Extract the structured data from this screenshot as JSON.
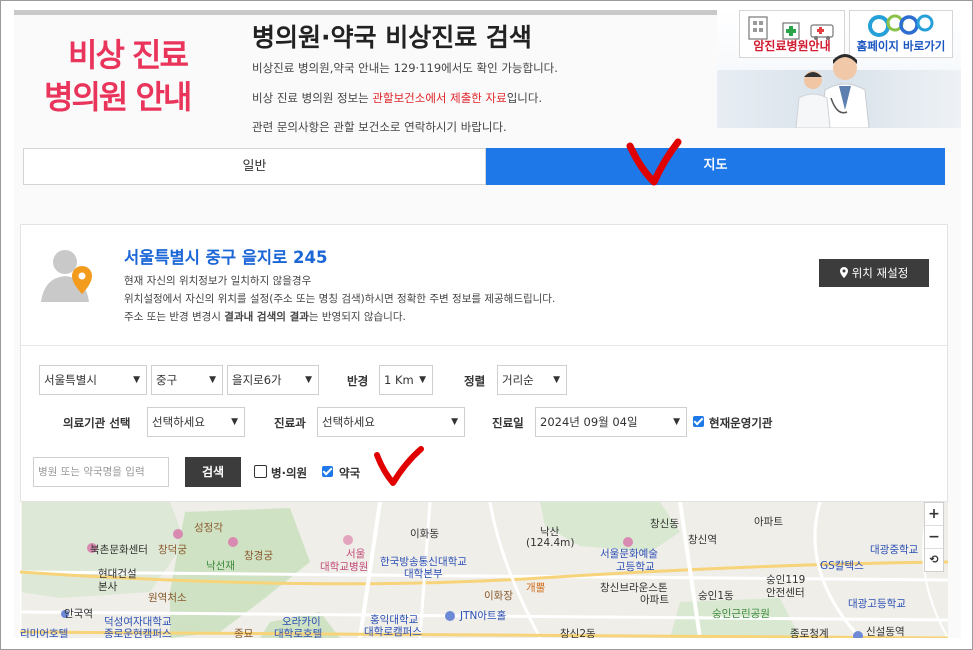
{
  "header": {
    "promo_line1": "비상 진료",
    "promo_line2": "병의원 안내",
    "title": "병의원·약국 비상진료 검색",
    "desc1": "비상진료 병의원,약국 안내는 129·119에서도 확인 가능합니다.",
    "desc2_pre": "비상 진료 병의원 정보는 ",
    "desc2_red": "관할보건소에서 제출한 자료",
    "desc2_post": "입니다.",
    "desc3": "관련 문의사항은 관할 보건소로 연락하시기 바랍니다.",
    "banner_btn1": "암진료병원안내",
    "banner_btn2": "홈페이지 바로가기",
    "banner_logo_text": "C C C"
  },
  "tabs": [
    {
      "label": "일반",
      "active": false
    },
    {
      "label": "지도",
      "active": true
    }
  ],
  "location": {
    "address": "서울특별시 중구 을지로 245",
    "info1": "현재 자신의 위치정보가 일치하지 않을경우",
    "info2": "위치설정에서 자신의 위치를 설정(주소 또는 명칭 검색)하시면 정확한 주변 정보를 제공해드립니다.",
    "info3_pre": "주소 또는 반경 변경시 ",
    "info3_bold": "결과내 검색의 결과",
    "info3_post": "는 반영되지 않습니다.",
    "reset_button": "위치 재설정"
  },
  "filters": {
    "city": "서울특별시",
    "district": "중구",
    "dong": "을지로6가",
    "radius_label": "반경",
    "radius": "1 Km",
    "sort_label": "정렬",
    "sort": "거리순",
    "facility_label": "의료기관 선택",
    "facility": "선택하세요",
    "dept_label": "진료과",
    "dept": "선택하세요",
    "date_label": "진료일",
    "date": "2024년 09월 04일",
    "open_now_label": "현재운영기관",
    "open_now": true,
    "search_placeholder": "병원 또는 약국명을 입력",
    "search_button": "검색",
    "clinic_label": "병·의원",
    "clinic_checked": false,
    "pharmacy_label": "약국",
    "pharmacy_checked": true
  },
  "map": {
    "labels": [
      "성정각",
      "창덕궁",
      "북촌문화센터",
      "현대건설",
      "본사",
      "원역처소",
      "낙선재",
      "창경궁",
      "서울",
      "대학교병원",
      "이화동",
      "한국방송통신대학교",
      "대학본부",
      "낙산",
      "(124.4m)",
      "이화장",
      "개뿔",
      "JTN아트홀",
      "홍익대학교",
      "대학로캠퍼스",
      "오라카이",
      "대학로호텔",
      "덕성여자대학교",
      "종로운현캠퍼스",
      "안국역",
      "리미어호텔",
      "종묘",
      "서울문화예술",
      "고등학교",
      "창신브라운스톤",
      "아파트",
      "숭인1동",
      "숭인근린공원",
      "창신2동",
      "창신역",
      "숭인119",
      "안전센터",
      "GS칼텍스",
      "대광중학교",
      "대광고등학교",
      "종로청계",
      "신설동역",
      "아파트",
      "창신동"
    ],
    "zoom_in": "+",
    "zoom_out": "−",
    "reset": "⟲"
  }
}
